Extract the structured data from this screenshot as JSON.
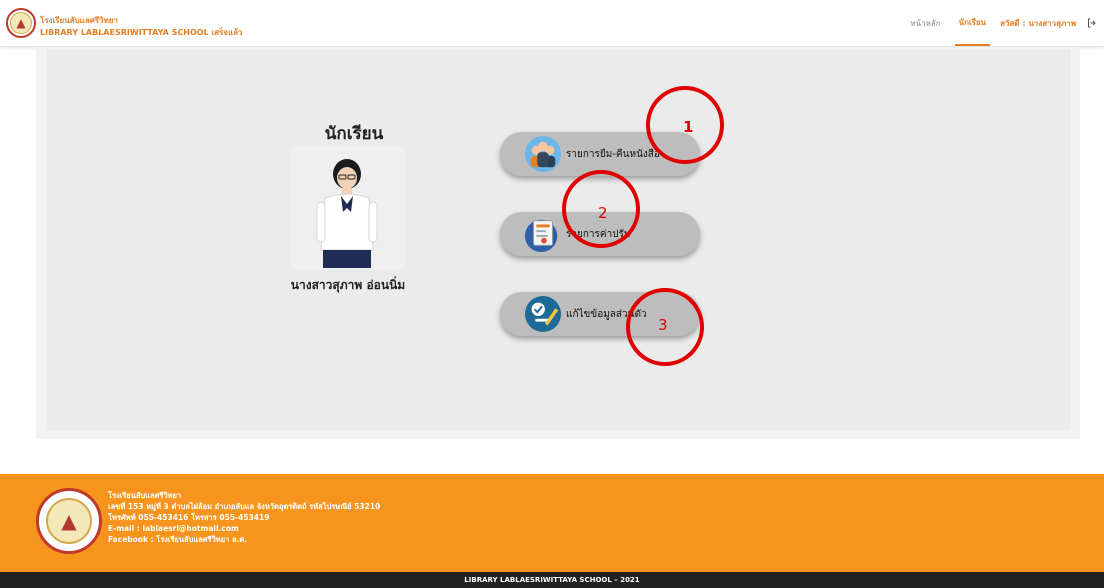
{
  "header": {
    "brand_line1": "โรงเรียนลับแลศรีวิทยา",
    "brand_line2": "LIBRARY LABLAESRIWITTAYA SCHOOL เสร็จแล้ว",
    "nav_home": "หน้าหลัก",
    "nav_student": "นักเรียน",
    "greeting": "สวัสดี : นางสาวสุภาพ"
  },
  "student": {
    "title": "นักเรียน",
    "name": "นางสาวสุภาพ อ่อนนิ่ม"
  },
  "menu": {
    "borrow_label": "รายการยืม-คืนหนังสือ",
    "fines_label": "รายการค่าปรับ",
    "profile_label": "แก้ไขข้อมูลส่วนตัว"
  },
  "annotations": {
    "one": "1",
    "two": "2",
    "three": "3",
    "color": "#e00000"
  },
  "footer": {
    "line1": "โรงเรียนลับแลศรีวิทยา",
    "line2": "เลขที่ 153 หมู่ที่ 3 ตำบลไผ่ล้อม อำเภอลับแล จังหวัดอุตรดิตถ์ รหัสไปรษณีย์ 53210",
    "line3": "โทรศัพท์ 055-453416 โทรสาร 055-453419",
    "line4": "E-mail : lablaesri@hotmail.com",
    "line5": "Facebook : โรงเรียนลับแลศรีวิทยา ล.ศ.",
    "copyright": "LIBRARY LABLAESRIWITTAYA SCHOOL – 2021"
  },
  "colors": {
    "accent": "#e67e22",
    "footer": "#f7941d",
    "button": "#bdbdbd"
  }
}
